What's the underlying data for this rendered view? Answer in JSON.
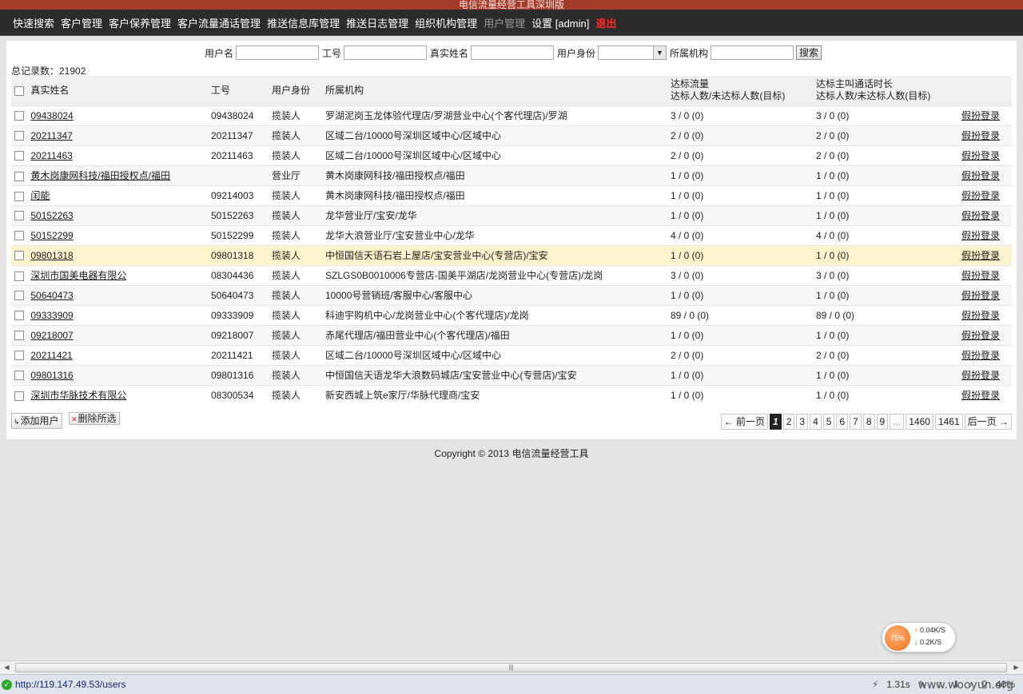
{
  "window": {
    "title": "电信流量经营工具深圳版"
  },
  "nav": [
    {
      "label": "快速搜索",
      "dim": false
    },
    {
      "label": "客户管理",
      "dim": false
    },
    {
      "label": "客户保养管理",
      "dim": false
    },
    {
      "label": "客户流量通话管理",
      "dim": false
    },
    {
      "label": "推送信息库管理",
      "dim": false
    },
    {
      "label": "推送日志管理",
      "dim": false
    },
    {
      "label": "组织机构管理",
      "dim": false
    },
    {
      "label": "用户管理",
      "dim": true
    },
    {
      "label": "设置 [admin]",
      "dim": false
    }
  ],
  "nav_logout": "退出",
  "search": {
    "username_label": "用户名",
    "username_value": "",
    "workid_label": "工号",
    "workid_value": "",
    "realname_label": "真实姓名",
    "realname_value": "",
    "role_label": "用户身份",
    "role_value": "",
    "org_label": "所属机构",
    "org_value": "",
    "submit_label": "搜索"
  },
  "total_label": "总记录数：21902",
  "table": {
    "headers": {
      "realname": "真实姓名",
      "workid": "工号",
      "role": "用户身份",
      "org": "所属机构",
      "traffic_1": "达标流量",
      "traffic_2": "达标人数/未达标人数(目标)",
      "call_1": "达标主叫通话时长",
      "call_2": "达标人数/未达标人数(目标)"
    },
    "rows": [
      {
        "name": "09438024",
        "workid": "09438024",
        "role": "揽装人",
        "org": "罗湖泥岗玉龙体验代理店/罗湖营业中心(个客代理店)/罗湖",
        "traffic": "3 / 0 (0)",
        "call": "3 / 0 (0)",
        "action": "假扮登录"
      },
      {
        "name": "20211347",
        "workid": "20211347",
        "role": "揽装人",
        "org": "区域二台/10000号深圳区域中心/区域中心",
        "traffic": "2 / 0 (0)",
        "call": "2 / 0 (0)",
        "action": "假扮登录"
      },
      {
        "name": "20211463",
        "workid": "20211463",
        "role": "揽装人",
        "org": "区域二台/10000号深圳区域中心/区域中心",
        "traffic": "2 / 0 (0)",
        "call": "2 / 0 (0)",
        "action": "假扮登录"
      },
      {
        "name": "黄木岗康网科技/福田授权点/福田",
        "workid": "",
        "role": "营业厅",
        "org": "黄木岗康网科技/福田授权点/福田",
        "traffic": "1 / 0 (0)",
        "call": "1 / 0 (0)",
        "action": "假扮登录"
      },
      {
        "name": "闰能",
        "workid": "09214003",
        "role": "揽装人",
        "org": "黄木岗康网科技/福田授权点/福田",
        "traffic": "1 / 0 (0)",
        "call": "1 / 0 (0)",
        "action": "假扮登录"
      },
      {
        "name": "50152263",
        "workid": "50152263",
        "role": "揽装人",
        "org": "龙华营业厅/宝安/龙华",
        "traffic": "1 / 0 (0)",
        "call": "1 / 0 (0)",
        "action": "假扮登录"
      },
      {
        "name": "50152299",
        "workid": "50152299",
        "role": "揽装人",
        "org": "龙华大浪营业厅/宝安营业中心/龙华",
        "traffic": "4 / 0 (0)",
        "call": "4 / 0 (0)",
        "action": "假扮登录"
      },
      {
        "name": "09801318",
        "workid": "09801318",
        "role": "揽装人",
        "org": "中恒国信天语石岩上屋店/宝安营业中心(专营店)/宝安",
        "traffic": "1 / 0 (0)",
        "call": "1 / 0 (0)",
        "action": "假扮登录"
      },
      {
        "name": "深圳市国美电器有限公",
        "workid": "08304436",
        "role": "揽装人",
        "org": "SZLGS0B0010006专营店-国美平湖店/龙岗营业中心(专营店)/龙岗",
        "traffic": "3 / 0 (0)",
        "call": "3 / 0 (0)",
        "action": "假扮登录"
      },
      {
        "name": "50640473",
        "workid": "50640473",
        "role": "揽装人",
        "org": "10000号营销班/客服中心/客服中心",
        "traffic": "1 / 0 (0)",
        "call": "1 / 0 (0)",
        "action": "假扮登录"
      },
      {
        "name": "09333909",
        "workid": "09333909",
        "role": "揽装人",
        "org": "科迪宇购机中心/龙岗营业中心(个客代理店)/龙岗",
        "traffic": "89 / 0 (0)",
        "call": "89 / 0 (0)",
        "action": "假扮登录"
      },
      {
        "name": "09218007",
        "workid": "09218007",
        "role": "揽装人",
        "org": "赤尾代理店/福田营业中心(个客代理店)/福田",
        "traffic": "1 / 0 (0)",
        "call": "1 / 0 (0)",
        "action": "假扮登录"
      },
      {
        "name": "20211421",
        "workid": "20211421",
        "role": "揽装人",
        "org": "区域二台/10000号深圳区域中心/区域中心",
        "traffic": "2 / 0 (0)",
        "call": "2 / 0 (0)",
        "action": "假扮登录"
      },
      {
        "name": "09801316",
        "workid": "09801316",
        "role": "揽装人",
        "org": "中恒国信天语龙华大浪数码城店/宝安营业中心(专营店)/宝安",
        "traffic": "1 / 0 (0)",
        "call": "1 / 0 (0)",
        "action": "假扮登录"
      },
      {
        "name": "深圳市华脉技术有限公",
        "workid": "08300534",
        "role": "揽装人",
        "org": "新安西城上筑e家厅/华脉代理商/宝安",
        "traffic": "1 / 0 (0)",
        "call": "1 / 0 (0)",
        "action": "假扮登录"
      }
    ]
  },
  "actions": {
    "add_user": "添加用户",
    "delete_selected": "删除所选"
  },
  "pager": {
    "prev": "← 前一页",
    "pages": [
      "1",
      "2",
      "3",
      "4",
      "5",
      "6",
      "7",
      "8",
      "9",
      "...",
      "1460",
      "1461"
    ],
    "current": "1",
    "next": "后一页 →"
  },
  "footer": "Copyright © 2013 电信流量经营工具",
  "net_widget": {
    "percent": "75%",
    "up": "0.04K/S",
    "down": "0.2K/S"
  },
  "statusbar": {
    "url": "http://119.147.49.53/users",
    "load_time": "1.31s",
    "zoom": "40%"
  },
  "watermark": "www.wooyun.org",
  "colors": {
    "accent": "#a53a2b",
    "nav_bg": "#2c2c2c",
    "logout": "#ff2a2a",
    "highlight_row": "#fdf3cc"
  }
}
